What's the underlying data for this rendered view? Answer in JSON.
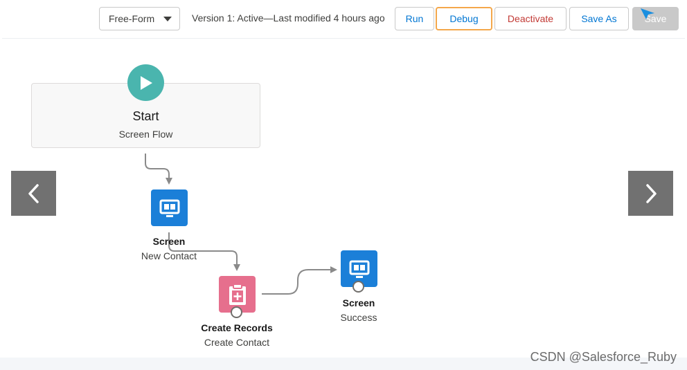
{
  "toolbar": {
    "layout_select": "Free-Form",
    "version_text": "Version 1: Active—Last modified 4 hours ago",
    "run_label": "Run",
    "debug_label": "Debug",
    "deactivate_label": "Deactivate",
    "save_as_label": "Save As",
    "save_label": "Save"
  },
  "flow": {
    "start": {
      "title": "Start",
      "subtitle": "Screen Flow",
      "icon": "play-icon"
    },
    "nodes": [
      {
        "type": "Screen",
        "label": "New Contact",
        "icon": "screen-icon",
        "color": "#1b7fd8"
      },
      {
        "type": "Create Records",
        "label": "Create Contact",
        "icon": "create-records-icon",
        "color": "#e66f8d"
      },
      {
        "type": "Screen",
        "label": "Success",
        "icon": "screen-icon",
        "color": "#1b7fd8"
      }
    ]
  },
  "navigation": {
    "prev_icon": "chevron-left-icon",
    "next_icon": "chevron-right-icon"
  },
  "watermark": "CSDN @Salesforce_Ruby",
  "colors": {
    "accent": "#0176d3",
    "start": "#4ab5ae",
    "screen": "#1b7fd8",
    "create": "#e66f8d",
    "danger": "#c23934",
    "focus": "#f4a74a"
  }
}
